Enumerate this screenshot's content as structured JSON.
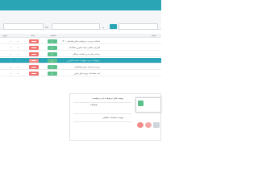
{
  "colors": {
    "primary": "#29a5b6",
    "danger": "#f0716f",
    "success": "#5cc08b",
    "header_bg": "#f1f3f5"
  },
  "toolbar": {
    "search_icon": "search-icon",
    "calendar_icon": "calendar-icon",
    "filter_icon": "filter-icon",
    "chevron_icon": "chevron-down-icon",
    "search_field_1_value": "",
    "search_field_2_value": ""
  },
  "table": {
    "headers": {
      "title": "عنوان",
      "count": "تعداد",
      "date": "تاریخ",
      "action": "عملیات"
    },
    "rows": [
      {
        "title": "سامانه مدیریت درخواست های پشتیبانی ۱۴۰۱",
        "num1": "—",
        "num2": "—",
        "selected": false
      },
      {
        "title": "گزارش عملکرد واحد فناوری اطلاعات",
        "num1": "—",
        "num2": "—",
        "selected": false
      },
      {
        "title": "برنامه زمان بندی جلسات هفتگی",
        "num1": "—",
        "num2": "—",
        "selected": false
      },
      {
        "title": "درخواست خرید تجهیزات سخت افزاری",
        "num1": "—",
        "num2": "—",
        "selected": true
      },
      {
        "title": "بررسی قرارداد های پیمانکاران",
        "num1": "—",
        "num2": "—",
        "selected": false
      },
      {
        "title": "ثبت مستندات پروژه های جاری",
        "num1": "—",
        "num2": "—",
        "selected": false
      }
    ]
  },
  "panel": {
    "label_1": "پیوست فایل مربوط به این درخواست",
    "label_2": "توضیحات",
    "label_3": "پیوست مستندات تکمیلی"
  },
  "footer": {
    "icon_left": "user-icon",
    "icon_right": "attach-icon"
  }
}
